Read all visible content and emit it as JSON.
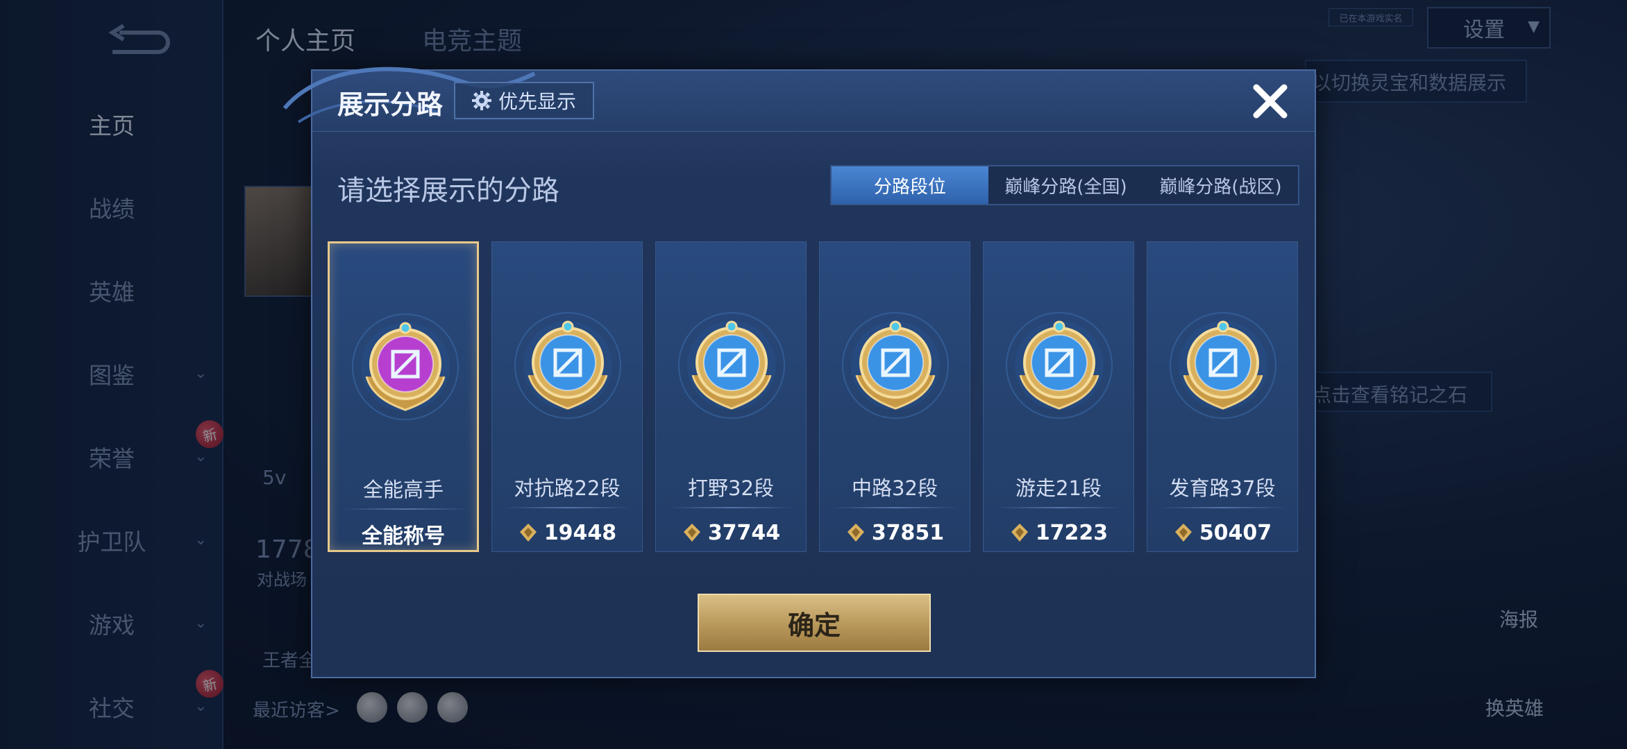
{
  "sidebar": {
    "items": [
      {
        "label": "主页",
        "active": true
      },
      {
        "label": "战绩"
      },
      {
        "label": "英雄"
      },
      {
        "label": "图鉴"
      },
      {
        "label": "荣誉"
      },
      {
        "label": "护卫队"
      },
      {
        "label": "游戏"
      },
      {
        "label": "社交"
      }
    ],
    "new_badge": "新"
  },
  "top_tabs": [
    "个人主页",
    "电竞主题"
  ],
  "settings": {
    "label": "设置",
    "tiny_label": "已在本游戏实名"
  },
  "background": {
    "partial_left_a": "5v",
    "partial_left_b": "1778",
    "partial_left_c": "对战场",
    "partial_left_d": "王者全",
    "visitors_label": "最近访客>",
    "right_hint_top": "以切换灵宝和数据展示",
    "right_hint_mid": "点击查看铭记之石",
    "poster_label": "海报",
    "change_hero_label": "换英雄"
  },
  "dialog": {
    "title": "展示分路",
    "priority_button": "优先显示",
    "subtitle": "请选择展示的分路",
    "segments": [
      "分路段位",
      "巅峰分路(全国)",
      "巅峰分路(战区)"
    ],
    "active_segment": 0,
    "cards": [
      {
        "name": "全能高手",
        "value": "全能称号",
        "selected": true,
        "emblem": "all-round-emblem-icon",
        "color": "#b63fd0"
      },
      {
        "name": "对抗路22段",
        "value": "19448",
        "emblem": "clash-lane-emblem-icon",
        "color": "#3b93e6"
      },
      {
        "name": "打野32段",
        "value": "37744",
        "emblem": "jungle-dragon-emblem-icon",
        "color": "#3b93e6"
      },
      {
        "name": "中路32段",
        "value": "37851",
        "emblem": "mid-lane-emblem-icon",
        "color": "#3b93e6"
      },
      {
        "name": "游走21段",
        "value": "17223",
        "emblem": "roam-wings-emblem-icon",
        "color": "#3b93e6"
      },
      {
        "name": "发育路37段",
        "value": "50407",
        "emblem": "farm-lane-emblem-icon",
        "color": "#3b93e6"
      }
    ],
    "confirm_button": "确定"
  },
  "colors": {
    "accent_blue": "#3f7bc9",
    "gold": "#d9bf86",
    "selected_border": "#e8c98a"
  }
}
